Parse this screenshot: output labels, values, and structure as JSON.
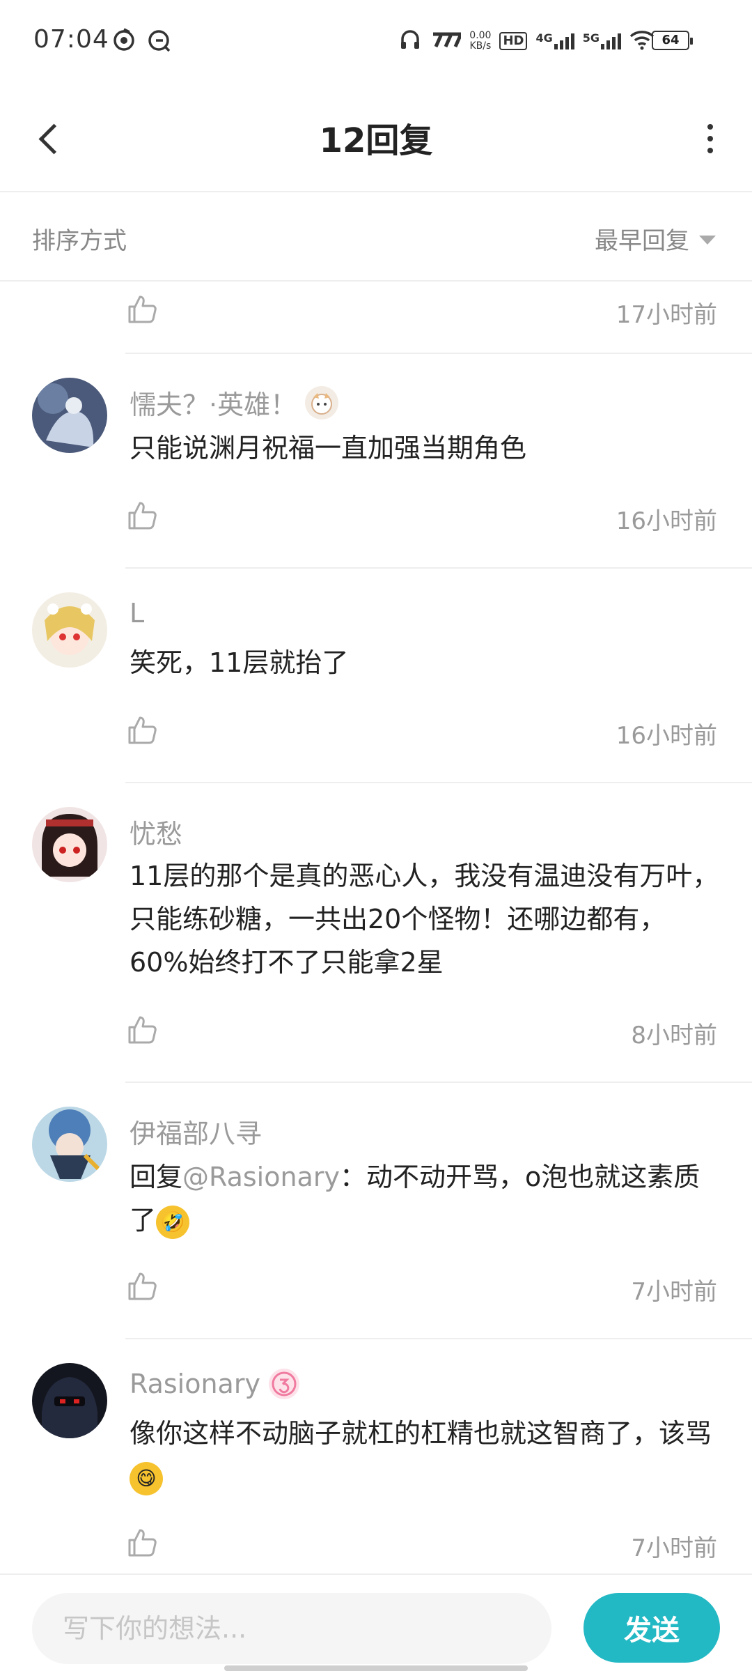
{
  "status_bar": {
    "time": "07:04",
    "net_speed_value": "0.00",
    "net_speed_unit": "KB/s",
    "hd_label": "HD",
    "net_4g": "4G",
    "net_5g": "5G",
    "battery_level": "64"
  },
  "header": {
    "title": "12回复"
  },
  "sort": {
    "label": "排序方式",
    "value": "最早回复"
  },
  "comments": [
    {
      "name": "",
      "content": "",
      "time": "17小时前"
    },
    {
      "name": "懦夫？·英雄！",
      "content": "只能说渊月祝福一直加强当期角色",
      "time": "16小时前"
    },
    {
      "name": "L",
      "content": "笑死，11层就抬了",
      "time": "16小时前"
    },
    {
      "name": "忧愁",
      "content": "11层的那个是真的恶心人，我没有温迪没有万叶，只能练砂糖，一共出20个怪物！还哪边都有，60%始终打不了只能拿2星",
      "time": "8小时前"
    },
    {
      "name": "伊福部八寻",
      "reply_prefix": "回复",
      "mention": "@Rasionary",
      "content": "：动不动开骂，o泡也就这素质了",
      "emoji": "rolling-on-floor-laughing",
      "time": "7小时前"
    },
    {
      "name": "Rasionary",
      "content": "像你这样不动脑子就杠的杠精也就这智商了，该骂",
      "emoji": "face-savoring-food",
      "time": "7小时前"
    }
  ],
  "composer": {
    "placeholder": "写下你的想法...",
    "send_label": "发送"
  },
  "colors": {
    "accent": "#22b8c4",
    "secondary_text": "#9a9a9a",
    "divider": "#eeeeee"
  }
}
